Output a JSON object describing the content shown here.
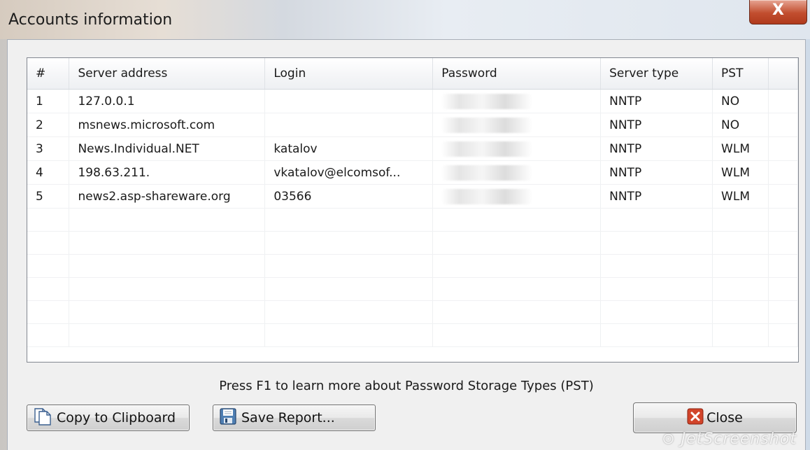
{
  "window": {
    "title": "Accounts information",
    "close_glyph": "X"
  },
  "table": {
    "columns": [
      "#",
      "Server address",
      "Login",
      "Password",
      "Server type",
      "PST"
    ],
    "rows": [
      {
        "num": "1",
        "server": "127.0.0.1",
        "login": "",
        "password_masked": true,
        "type": "NNTP",
        "pst": "NO"
      },
      {
        "num": "2",
        "server": "msnews.microsoft.com",
        "login": "",
        "password_masked": true,
        "type": "NNTP",
        "pst": "NO"
      },
      {
        "num": "3",
        "server": "News.Individual.NET",
        "login": "katalov",
        "password_masked": true,
        "type": "NNTP",
        "pst": "WLM"
      },
      {
        "num": "4",
        "server": "198.63.211.",
        "login": "vkatalov@elcomsof...",
        "password_masked": true,
        "type": "NNTP",
        "pst": "WLM"
      },
      {
        "num": "5",
        "server": "news2.asp-shareware.org",
        "login": "03566",
        "password_masked": true,
        "type": "NNTP",
        "pst": "WLM"
      }
    ],
    "empty_rows": 6
  },
  "help_text": "Press F1 to learn more about Password Storage Types (PST)",
  "buttons": {
    "copy": {
      "label": "Copy to Clipboard",
      "icon": "copy-icon"
    },
    "save": {
      "label": "Save Report...",
      "icon": "save-icon"
    },
    "close": {
      "label": "Close",
      "icon": "close-red-x-icon"
    }
  },
  "watermark": "JetScreenshot",
  "colors": {
    "close_red": "#c9442a",
    "header_bg": "#f4f5f7"
  }
}
